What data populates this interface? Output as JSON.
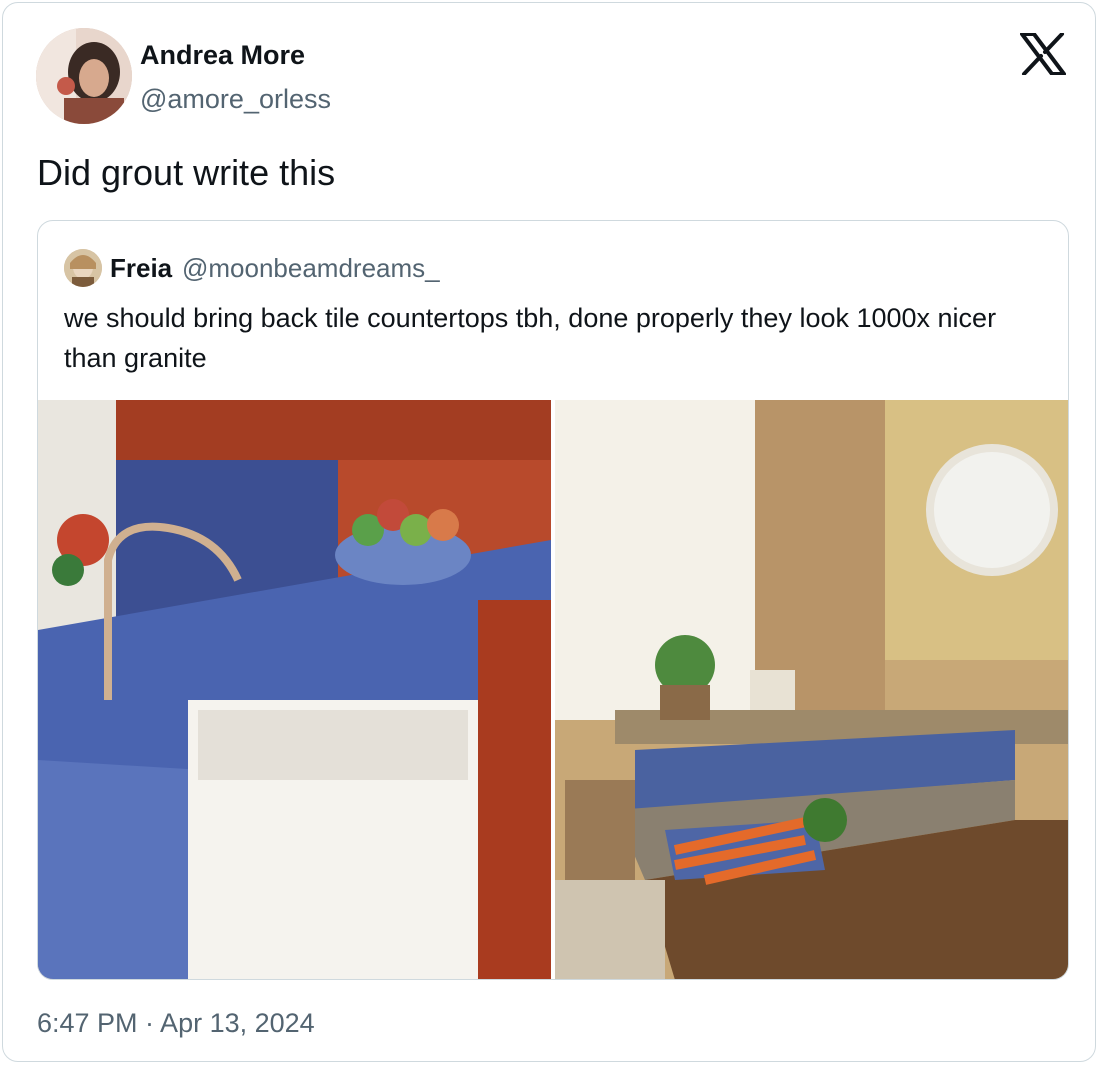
{
  "post": {
    "author_name": "Andrea More",
    "author_handle": "@amore_orless",
    "text": "Did grout write this",
    "timestamp": "6:47 PM · Apr 13, 2024",
    "platform_icon": "x-logo-icon"
  },
  "quoted_post": {
    "author_name": "Freia",
    "author_handle": "@moonbeamdreams_",
    "text": "we should bring back tile countertops tbh, done properly they look 1000x nicer than granite"
  },
  "colors": {
    "text_primary": "#0f1419",
    "text_secondary": "#536471",
    "border": "#cfd9de"
  }
}
